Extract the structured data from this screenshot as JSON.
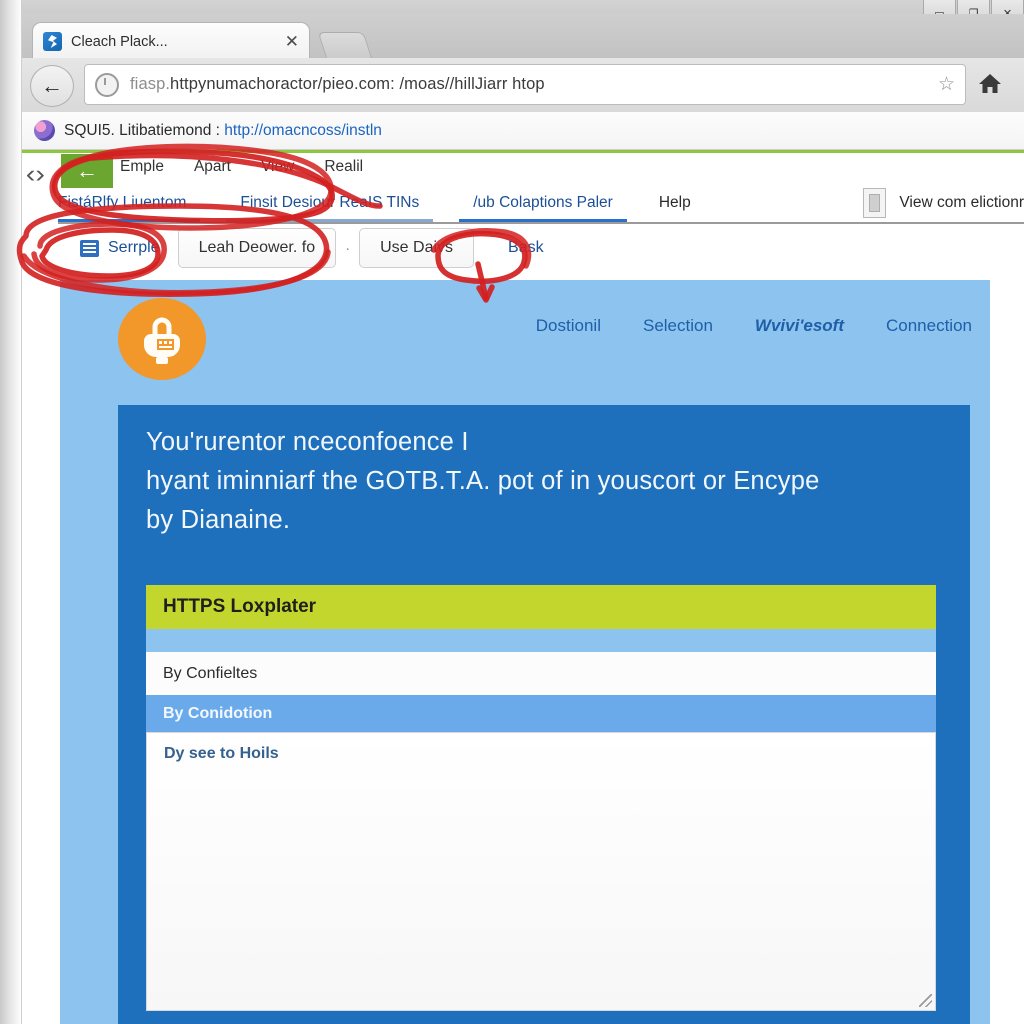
{
  "window": {
    "controls": [
      "minimize",
      "restore",
      "close"
    ],
    "control_glyphs": [
      "▭",
      "❐",
      "✕"
    ]
  },
  "browser": {
    "tab": {
      "title": "Cleach Plack...",
      "close_label": "✕",
      "favicon": "page-favicon"
    },
    "new_tab_label": "",
    "back_label": "←",
    "omnibox": {
      "value": "fiasp.httpynumachoractor/pieo.com: /moas//hillJiarr htop",
      "value_prefix": "fiasp.",
      "value_rest": "httpynumachoractor/pieo.com: /moas//hillJiarr htop",
      "star_label": "☆",
      "security_icon": "info-circle-icon"
    },
    "home_label": "⌂",
    "menu_label": "≡",
    "bookmark": {
      "label": "SQUI5. Litibatiemond :",
      "link": "http://omacncoss/instln"
    }
  },
  "app": {
    "code_icon_label": "‹›",
    "back_button_label": "←",
    "menu": [
      "Emple",
      "Apart",
      "View",
      "Realil"
    ],
    "tabs": [
      {
        "label": "FistáRlfy Liuentom",
        "active": true
      },
      {
        "label": "Finsit Desiour ReaIS TINs",
        "active": true
      },
      {
        "label": "/ub Colaptions Paler",
        "active": true
      },
      {
        "label": "Help",
        "active": false
      }
    ],
    "view_collection": {
      "label": "View com elictionr",
      "icon": "document-icon"
    },
    "buttons": {
      "sample": "Serrple",
      "sample_icon": "grid-table-icon",
      "dropdown": "Leah Deower. fo",
      "separator": "·",
      "use_days": "Use Daivs",
      "back_link": "Bask"
    }
  },
  "site": {
    "logo_icon": "padlock-icon",
    "nav": [
      {
        "label": "Dostionil",
        "style": "normal"
      },
      {
        "label": "Selection",
        "style": "normal"
      },
      {
        "label": "Wvivi'esoft",
        "style": "italic"
      },
      {
        "label": "Connection",
        "style": "normal"
      }
    ],
    "hero": {
      "lines": [
        "You'rurentor nceconfoence I",
        "hyant iminniarf the GOTB.T.A. pot of in youscort or Encype",
        "by Dianaine."
      ]
    },
    "card": {
      "header": "HTTPS Loxplater",
      "row_white": "By Confieltes",
      "row_blue": "By Conidotion",
      "textarea_text": "Dy see to Hoils"
    }
  },
  "annotations": {
    "color": "#d32020",
    "shapes": [
      "circle-around-app-menu-and-tabs",
      "circle-around-sample-button",
      "circle-around-toolbar-row",
      "circle-with-arrow-pointing-to-back-link"
    ]
  },
  "colors": {
    "accent_green": "#8dc63f",
    "app_back_green": "#6aa630",
    "site_bg": "#8cc3ef",
    "hero_blue": "#1e6fbc",
    "card_green": "#c2d62e",
    "logo_orange": "#f2972a",
    "link_blue": "#1b4f96",
    "ink_red": "#d32020"
  }
}
